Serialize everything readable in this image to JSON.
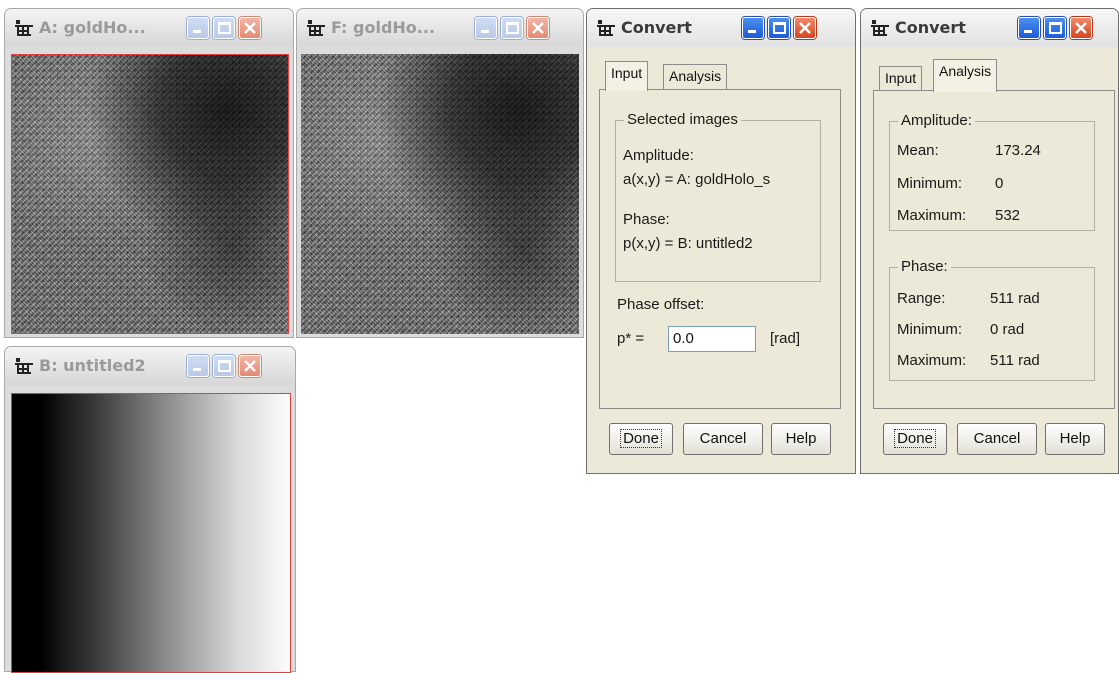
{
  "windows": {
    "img_a": {
      "title": "A: goldHo..."
    },
    "img_f": {
      "title": "F: goldHo..."
    },
    "img_b": {
      "title": "B: untitled2"
    }
  },
  "dialog_input": {
    "title": "Convert",
    "tabs": [
      "Input",
      "Analysis"
    ],
    "active_tab": "Input",
    "selected_group": {
      "legend": "Selected images",
      "amplitude_label": "Amplitude:",
      "amplitude_value": "a(x,y) = A: goldHolo_s",
      "phase_label": "Phase:",
      "phase_value": "p(x,y) = B: untitled2"
    },
    "phase_offset": {
      "label": "Phase offset:",
      "prefix": "p* =",
      "value": "0.0",
      "unit": "[rad]"
    },
    "buttons": {
      "done": "Done",
      "cancel": "Cancel",
      "help": "Help"
    }
  },
  "dialog_analysis": {
    "title": "Convert",
    "tabs": [
      "Input",
      "Analysis"
    ],
    "active_tab": "Analysis",
    "amplitude": {
      "legend": "Amplitude:",
      "rows": [
        {
          "label": "Mean:",
          "value": "173.24"
        },
        {
          "label": "Minimum:",
          "value": "0"
        },
        {
          "label": "Maximum:",
          "value": "532"
        }
      ]
    },
    "phase": {
      "legend": "Phase:",
      "rows": [
        {
          "label": "Range:",
          "value": "511 rad"
        },
        {
          "label": "Minimum:",
          "value": "0 rad"
        },
        {
          "label": "Maximum:",
          "value": "511 rad"
        }
      ]
    },
    "buttons": {
      "done": "Done",
      "cancel": "Cancel",
      "help": "Help"
    }
  },
  "colors": {
    "title_blue": "#1c5bd8",
    "close_red": "#d9431e",
    "selection_red": "#e04040",
    "dialog_bg": "#ece9d8"
  }
}
